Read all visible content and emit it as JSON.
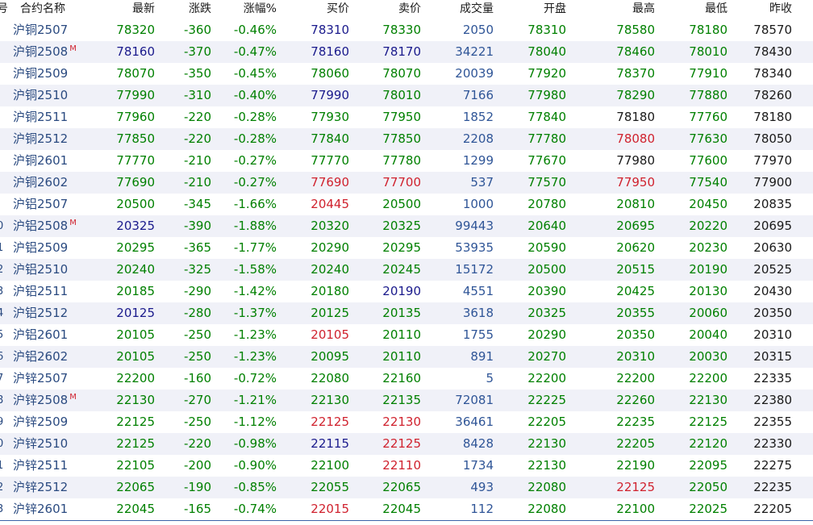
{
  "header": {
    "idx": "号",
    "name": "合约名称",
    "last": "最新",
    "change": "涨跌",
    "pct": "涨幅%",
    "bid": "买价",
    "ask": "卖价",
    "volume": "成交量",
    "open": "开盘",
    "high": "最高",
    "low": "最低",
    "prev": "昨收"
  },
  "colors": {
    "up": "#d0222e",
    "down": "#008000",
    "flat": "#1a1a8c",
    "neutral": "#1a1a1a",
    "volume": "#2f5597"
  },
  "rows": [
    {
      "idx": "",
      "name": "沪铜2507",
      "mark": "",
      "last": "78320",
      "change": "-360",
      "pct": "-0.46%",
      "bid": "78310",
      "ask": "78330",
      "volume": "2050",
      "open": "78310",
      "high": "78580",
      "low": "78180",
      "prev": "78570",
      "cLast": "green",
      "cBid": "navy",
      "cAsk": "green",
      "cOpen": "green",
      "cHigh": "green",
      "cLow": "green"
    },
    {
      "idx": "",
      "name": "沪铜2508",
      "mark": "M",
      "last": "78160",
      "change": "-370",
      "pct": "-0.47%",
      "bid": "78160",
      "ask": "78170",
      "volume": "34221",
      "open": "78040",
      "high": "78460",
      "low": "78010",
      "prev": "78430",
      "cLast": "navy",
      "cBid": "navy",
      "cAsk": "navy",
      "cOpen": "green",
      "cHigh": "green",
      "cLow": "green"
    },
    {
      "idx": "",
      "name": "沪铜2509",
      "mark": "",
      "last": "78070",
      "change": "-350",
      "pct": "-0.45%",
      "bid": "78060",
      "ask": "78070",
      "volume": "20039",
      "open": "77920",
      "high": "78370",
      "low": "77910",
      "prev": "78340",
      "cLast": "green",
      "cBid": "green",
      "cAsk": "green",
      "cOpen": "green",
      "cHigh": "green",
      "cLow": "green"
    },
    {
      "idx": "",
      "name": "沪铜2510",
      "mark": "",
      "last": "77990",
      "change": "-310",
      "pct": "-0.40%",
      "bid": "77990",
      "ask": "78010",
      "volume": "7166",
      "open": "77980",
      "high": "78290",
      "low": "77880",
      "prev": "78260",
      "cLast": "green",
      "cBid": "navy",
      "cAsk": "green",
      "cOpen": "green",
      "cHigh": "green",
      "cLow": "green"
    },
    {
      "idx": "",
      "name": "沪铜2511",
      "mark": "",
      "last": "77960",
      "change": "-220",
      "pct": "-0.28%",
      "bid": "77930",
      "ask": "77950",
      "volume": "1852",
      "open": "77840",
      "high": "78180",
      "low": "77760",
      "prev": "78180",
      "cLast": "green",
      "cBid": "green",
      "cAsk": "green",
      "cOpen": "green",
      "cHigh": "black",
      "cLow": "green"
    },
    {
      "idx": "",
      "name": "沪铜2512",
      "mark": "",
      "last": "77850",
      "change": "-220",
      "pct": "-0.28%",
      "bid": "77840",
      "ask": "77850",
      "volume": "2208",
      "open": "77780",
      "high": "78080",
      "low": "77630",
      "prev": "78050",
      "cLast": "green",
      "cBid": "green",
      "cAsk": "green",
      "cOpen": "green",
      "cHigh": "red",
      "cLow": "green"
    },
    {
      "idx": "",
      "name": "沪铜2601",
      "mark": "",
      "last": "77770",
      "change": "-210",
      "pct": "-0.27%",
      "bid": "77770",
      "ask": "77780",
      "volume": "1299",
      "open": "77670",
      "high": "77980",
      "low": "77600",
      "prev": "77970",
      "cLast": "green",
      "cBid": "green",
      "cAsk": "green",
      "cOpen": "green",
      "cHigh": "black",
      "cLow": "green"
    },
    {
      "idx": "",
      "name": "沪铜2602",
      "mark": "",
      "last": "77690",
      "change": "-210",
      "pct": "-0.27%",
      "bid": "77690",
      "ask": "77700",
      "volume": "537",
      "open": "77570",
      "high": "77950",
      "low": "77540",
      "prev": "77900",
      "cLast": "green",
      "cBid": "red",
      "cAsk": "red",
      "cOpen": "green",
      "cHigh": "red",
      "cLow": "green"
    },
    {
      "idx": "",
      "name": "沪铝2507",
      "mark": "",
      "last": "20500",
      "change": "-345",
      "pct": "-1.66%",
      "bid": "20445",
      "ask": "20500",
      "volume": "1000",
      "open": "20780",
      "high": "20810",
      "low": "20450",
      "prev": "20835",
      "cLast": "green",
      "cBid": "red",
      "cAsk": "green",
      "cOpen": "green",
      "cHigh": "green",
      "cLow": "green"
    },
    {
      "idx": "0",
      "name": "沪铝2508",
      "mark": "M",
      "last": "20325",
      "change": "-390",
      "pct": "-1.88%",
      "bid": "20320",
      "ask": "20325",
      "volume": "99443",
      "open": "20640",
      "high": "20695",
      "low": "20220",
      "prev": "20695",
      "cLast": "navy",
      "cBid": "green",
      "cAsk": "green",
      "cOpen": "green",
      "cHigh": "green",
      "cLow": "green"
    },
    {
      "idx": "1",
      "name": "沪铝2509",
      "mark": "",
      "last": "20295",
      "change": "-365",
      "pct": "-1.77%",
      "bid": "20290",
      "ask": "20295",
      "volume": "53935",
      "open": "20590",
      "high": "20620",
      "low": "20230",
      "prev": "20630",
      "cLast": "green",
      "cBid": "green",
      "cAsk": "green",
      "cOpen": "green",
      "cHigh": "green",
      "cLow": "green"
    },
    {
      "idx": "2",
      "name": "沪铝2510",
      "mark": "",
      "last": "20240",
      "change": "-325",
      "pct": "-1.58%",
      "bid": "20240",
      "ask": "20245",
      "volume": "15172",
      "open": "20500",
      "high": "20515",
      "low": "20190",
      "prev": "20525",
      "cLast": "green",
      "cBid": "green",
      "cAsk": "green",
      "cOpen": "green",
      "cHigh": "green",
      "cLow": "green"
    },
    {
      "idx": "3",
      "name": "沪铝2511",
      "mark": "",
      "last": "20185",
      "change": "-290",
      "pct": "-1.42%",
      "bid": "20180",
      "ask": "20190",
      "volume": "4551",
      "open": "20390",
      "high": "20425",
      "low": "20130",
      "prev": "20430",
      "cLast": "green",
      "cBid": "green",
      "cAsk": "navy",
      "cOpen": "green",
      "cHigh": "green",
      "cLow": "green"
    },
    {
      "idx": "4",
      "name": "沪铝2512",
      "mark": "",
      "last": "20125",
      "change": "-280",
      "pct": "-1.37%",
      "bid": "20125",
      "ask": "20135",
      "volume": "3618",
      "open": "20325",
      "high": "20355",
      "low": "20060",
      "prev": "20350",
      "cLast": "navy",
      "cBid": "green",
      "cAsk": "green",
      "cOpen": "green",
      "cHigh": "green",
      "cLow": "green"
    },
    {
      "idx": "5",
      "name": "沪铝2601",
      "mark": "",
      "last": "20105",
      "change": "-250",
      "pct": "-1.23%",
      "bid": "20105",
      "ask": "20110",
      "volume": "1755",
      "open": "20290",
      "high": "20350",
      "low": "20040",
      "prev": "20310",
      "cLast": "green",
      "cBid": "red",
      "cAsk": "green",
      "cOpen": "green",
      "cHigh": "green",
      "cLow": "green"
    },
    {
      "idx": "6",
      "name": "沪铝2602",
      "mark": "",
      "last": "20105",
      "change": "-250",
      "pct": "-1.23%",
      "bid": "20095",
      "ask": "20110",
      "volume": "891",
      "open": "20270",
      "high": "20310",
      "low": "20030",
      "prev": "20315",
      "cLast": "green",
      "cBid": "green",
      "cAsk": "green",
      "cOpen": "green",
      "cHigh": "green",
      "cLow": "green"
    },
    {
      "idx": "7",
      "name": "沪锌2507",
      "mark": "",
      "last": "22200",
      "change": "-160",
      "pct": "-0.72%",
      "bid": "22080",
      "ask": "22160",
      "volume": "5",
      "open": "22200",
      "high": "22200",
      "low": "22200",
      "prev": "22335",
      "cLast": "green",
      "cBid": "green",
      "cAsk": "green",
      "cOpen": "green",
      "cHigh": "green",
      "cLow": "green"
    },
    {
      "idx": "8",
      "name": "沪锌2508",
      "mark": "M",
      "last": "22130",
      "change": "-270",
      "pct": "-1.21%",
      "bid": "22130",
      "ask": "22135",
      "volume": "72081",
      "open": "22225",
      "high": "22260",
      "low": "22130",
      "prev": "22380",
      "cLast": "green",
      "cBid": "green",
      "cAsk": "green",
      "cOpen": "green",
      "cHigh": "green",
      "cLow": "green"
    },
    {
      "idx": "9",
      "name": "沪锌2509",
      "mark": "",
      "last": "22125",
      "change": "-250",
      "pct": "-1.12%",
      "bid": "22125",
      "ask": "22130",
      "volume": "36461",
      "open": "22205",
      "high": "22235",
      "low": "22125",
      "prev": "22355",
      "cLast": "green",
      "cBid": "red",
      "cAsk": "red",
      "cOpen": "green",
      "cHigh": "green",
      "cLow": "green"
    },
    {
      "idx": "0",
      "name": "沪锌2510",
      "mark": "",
      "last": "22125",
      "change": "-220",
      "pct": "-0.98%",
      "bid": "22115",
      "ask": "22125",
      "volume": "8428",
      "open": "22130",
      "high": "22205",
      "low": "22120",
      "prev": "22330",
      "cLast": "green",
      "cBid": "navy",
      "cAsk": "red",
      "cOpen": "green",
      "cHigh": "green",
      "cLow": "green"
    },
    {
      "idx": "1",
      "name": "沪锌2511",
      "mark": "",
      "last": "22105",
      "change": "-200",
      "pct": "-0.90%",
      "bid": "22100",
      "ask": "22110",
      "volume": "1734",
      "open": "22130",
      "high": "22190",
      "low": "22095",
      "prev": "22275",
      "cLast": "green",
      "cBid": "green",
      "cAsk": "red",
      "cOpen": "green",
      "cHigh": "green",
      "cLow": "green"
    },
    {
      "idx": "2",
      "name": "沪锌2512",
      "mark": "",
      "last": "22065",
      "change": "-190",
      "pct": "-0.85%",
      "bid": "22055",
      "ask": "22065",
      "volume": "493",
      "open": "22080",
      "high": "22125",
      "low": "22050",
      "prev": "22235",
      "cLast": "green",
      "cBid": "green",
      "cAsk": "green",
      "cOpen": "green",
      "cHigh": "red",
      "cLow": "green"
    },
    {
      "idx": "3",
      "name": "沪锌2601",
      "mark": "",
      "last": "22045",
      "change": "-165",
      "pct": "-0.74%",
      "bid": "22015",
      "ask": "22045",
      "volume": "112",
      "open": "22080",
      "high": "22100",
      "low": "22025",
      "prev": "22205",
      "cLast": "green",
      "cBid": "red",
      "cAsk": "green",
      "cOpen": "green",
      "cHigh": "green",
      "cLow": "green",
      "selected": true
    }
  ]
}
